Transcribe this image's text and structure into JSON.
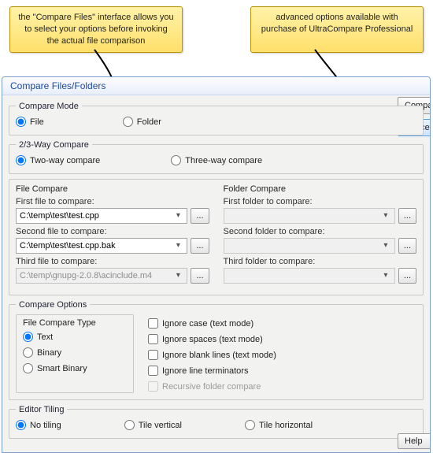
{
  "callouts": {
    "left": "the \"Compare Files\" interface allows you to select your options before invoking the actual file comparison",
    "right": "advanced options available with purchase of UltraCompare Professional"
  },
  "dialog": {
    "title": "Compare Files/Folders",
    "buttons": {
      "compare": "Compare",
      "cancel": "Cancel",
      "help": "Help"
    }
  },
  "compareMode": {
    "legend": "Compare Mode",
    "file": "File",
    "folder": "Folder"
  },
  "wayCompare": {
    "legend": "2/3-Way Compare",
    "two": "Two-way compare",
    "three": "Three-way compare"
  },
  "fileCompare": {
    "title": "File Compare",
    "first_label": "First file to compare:",
    "first_value": "C:\\temp\\test\\test.cpp",
    "second_label": "Second file to compare:",
    "second_value": "C:\\temp\\test\\test.cpp.bak",
    "third_label": "Third file to compare:",
    "third_value": "C:\\temp\\gnupg-2.0.8\\acinclude.m4",
    "browse": "..."
  },
  "folderCompare": {
    "title": "Folder Compare",
    "first_label": "First folder to compare:",
    "second_label": "Second folder to compare:",
    "third_label": "Third folder to compare:",
    "browse": "..."
  },
  "compareOptions": {
    "legend": "Compare Options",
    "type_legend": "File Compare Type",
    "text": "Text",
    "binary": "Binary",
    "smart_binary": "Smart Binary",
    "ignore_case": "Ignore case (text mode)",
    "ignore_spaces": "Ignore spaces (text mode)",
    "ignore_blank": "Ignore blank lines (text mode)",
    "ignore_term": "Ignore line terminators",
    "recursive": "Recursive folder compare"
  },
  "tiling": {
    "legend": "Editor Tiling",
    "none": "No tiling",
    "vertical": "Tile vertical",
    "horizontal": "Tile horizontal"
  }
}
